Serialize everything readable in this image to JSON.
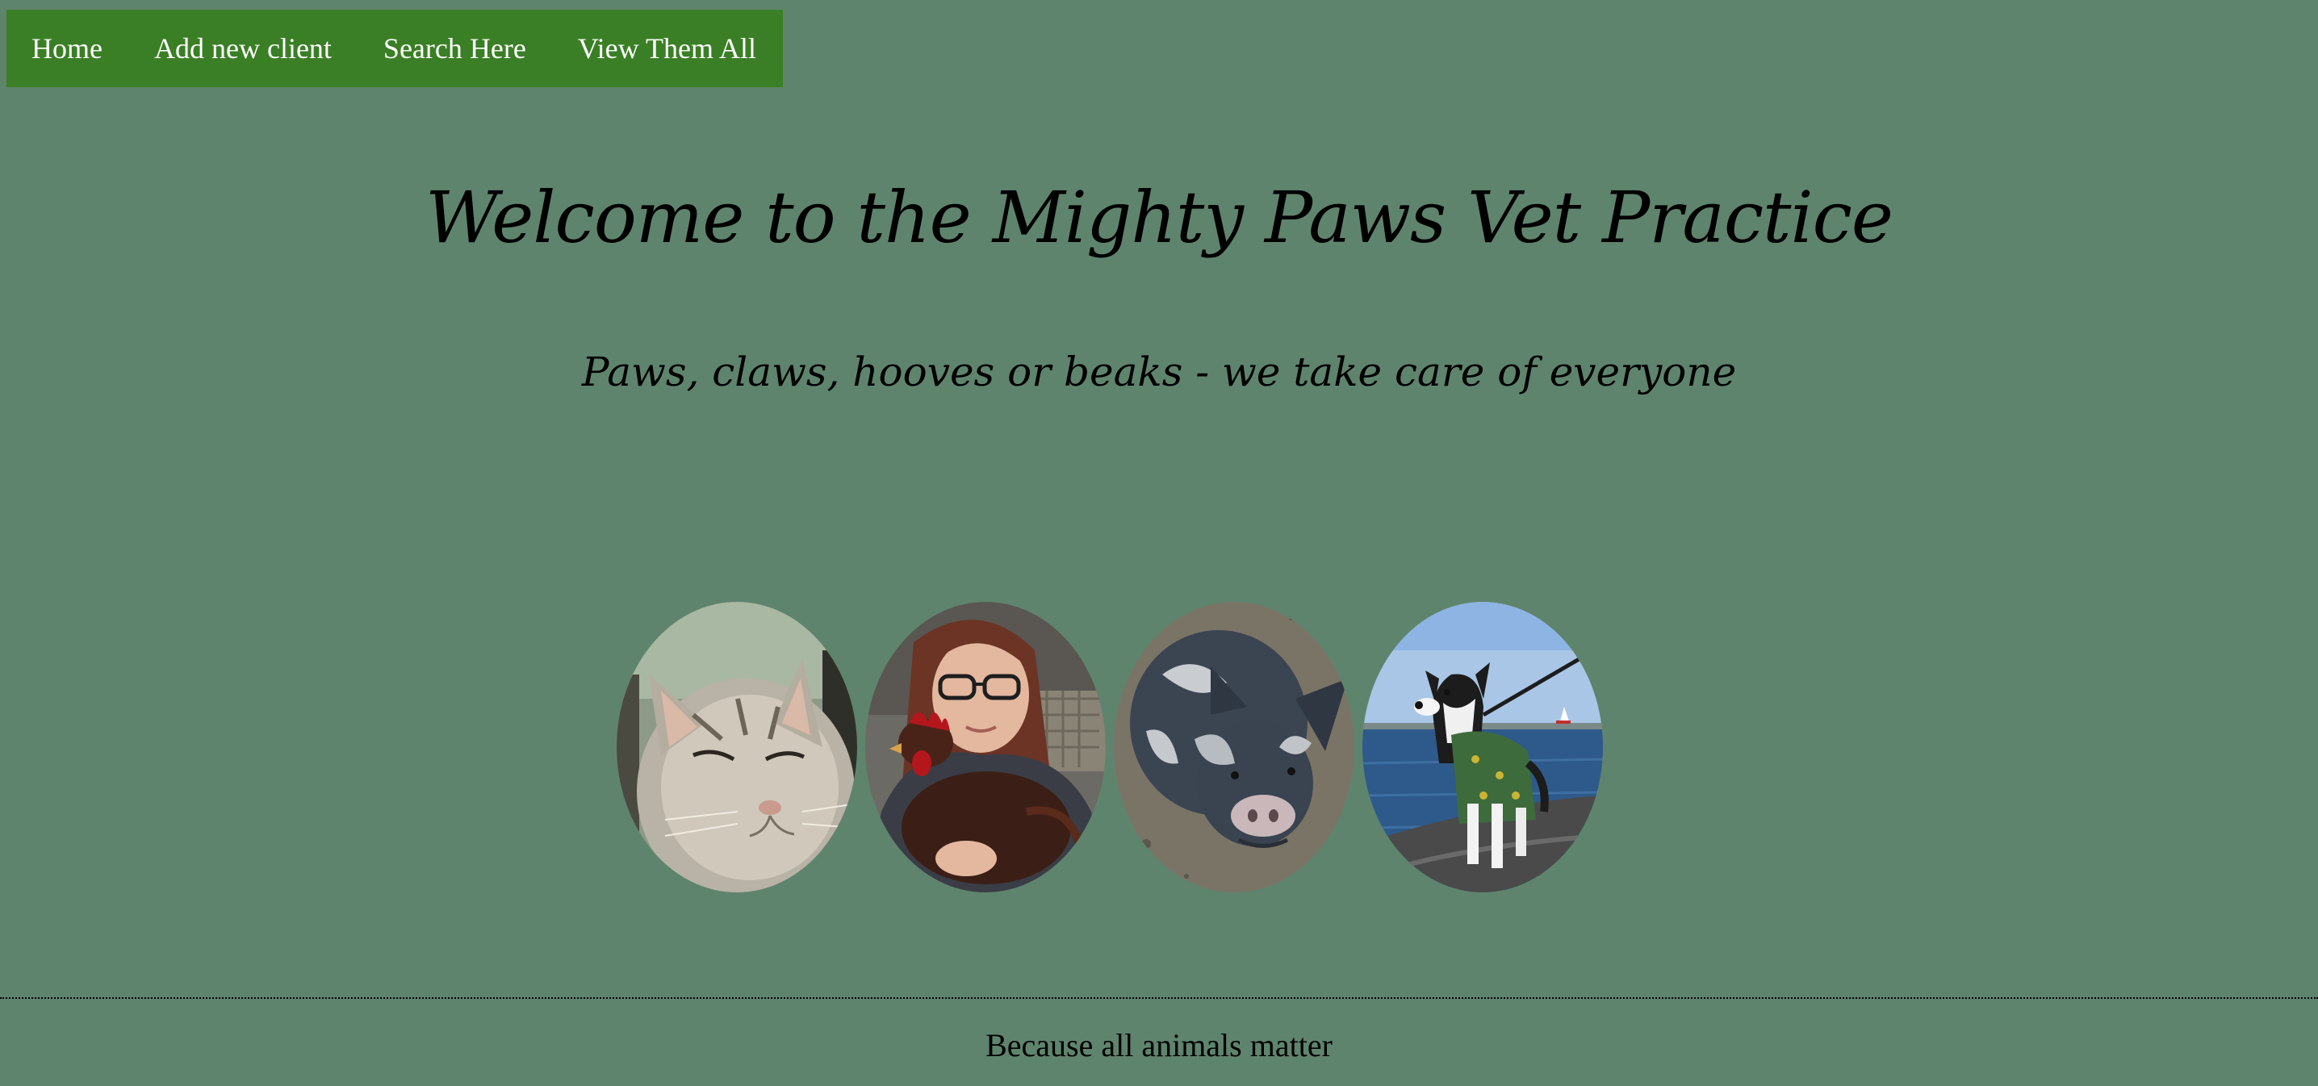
{
  "nav": {
    "items": [
      {
        "label": "Home"
      },
      {
        "label": "Add new client"
      },
      {
        "label": "Search Here"
      },
      {
        "label": "View Them All"
      }
    ]
  },
  "hero": {
    "title": "Welcome to the Mighty Paws Vet Practice",
    "subtitle": "Paws, claws, hooves or beaks - we take care of everyone"
  },
  "gallery": {
    "photos": [
      {
        "name": "cat-photo"
      },
      {
        "name": "woman-with-chicken-photo"
      },
      {
        "name": "pig-photo"
      },
      {
        "name": "dog-photo"
      }
    ]
  },
  "footer": {
    "tagline": "Because all animals matter"
  },
  "colors": {
    "background": "#5f846d",
    "navbar": "#3a7f25",
    "nav_text": "#ffffff",
    "text": "#000000"
  }
}
